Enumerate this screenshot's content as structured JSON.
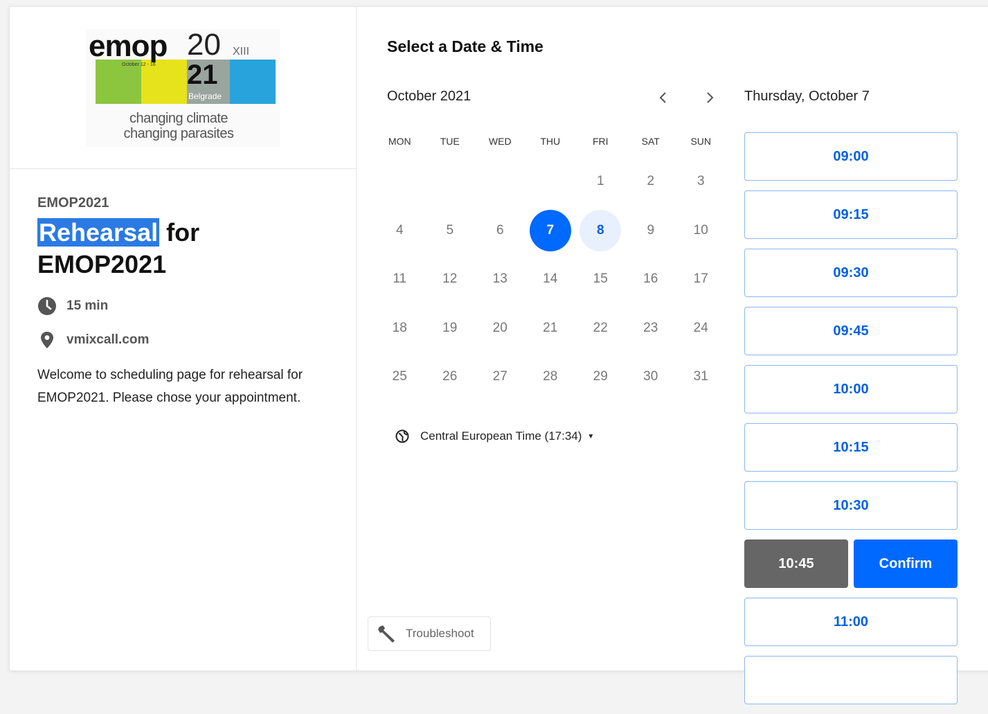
{
  "logo": {
    "word": "emop",
    "year_top": "20",
    "year_bottom": "21",
    "roman": "XIII",
    "dates": "October 12 - 16",
    "city": "Belgrade",
    "tagline_1": "changing climate",
    "tagline_2": "changing parasites"
  },
  "event": {
    "organizer": "EMOP2021",
    "title_highlight": "Rehearsal",
    "title_rest": " for EMOP2021",
    "duration": "15 min",
    "location": "vmixcall.com",
    "description": "Welcome to scheduling page for rehearsal for EMOP2021. Please chose your appointment."
  },
  "calendar": {
    "heading": "Select a Date & Time",
    "month": "October 2021",
    "weekdays": [
      "MON",
      "TUE",
      "WED",
      "THU",
      "FRI",
      "SAT",
      "SUN"
    ],
    "days": [
      "",
      "",
      "",
      "",
      "1",
      "2",
      "3",
      "4",
      "5",
      "6",
      "7",
      "8",
      "9",
      "10",
      "11",
      "12",
      "13",
      "14",
      "15",
      "16",
      "17",
      "18",
      "19",
      "20",
      "21",
      "22",
      "23",
      "24",
      "25",
      "26",
      "27",
      "28",
      "29",
      "30",
      "31"
    ],
    "selected_day": "7",
    "available_days": [
      "8"
    ],
    "timezone": "Central European Time (17:34)"
  },
  "timeslots": {
    "date_label": "Thursday, October 7",
    "slots_before": [
      "09:00",
      "09:15",
      "09:30",
      "09:45",
      "10:00",
      "10:15",
      "10:30"
    ],
    "selected_slot": "10:45",
    "confirm_label": "Confirm",
    "slots_after": [
      "11:00"
    ]
  },
  "troubleshoot_label": "Troubleshoot",
  "colors": {
    "primary": "#0069ff",
    "slot_text": "#0060e6",
    "selected_slot_bg": "#666666",
    "highlight": "#2b7ae4"
  }
}
